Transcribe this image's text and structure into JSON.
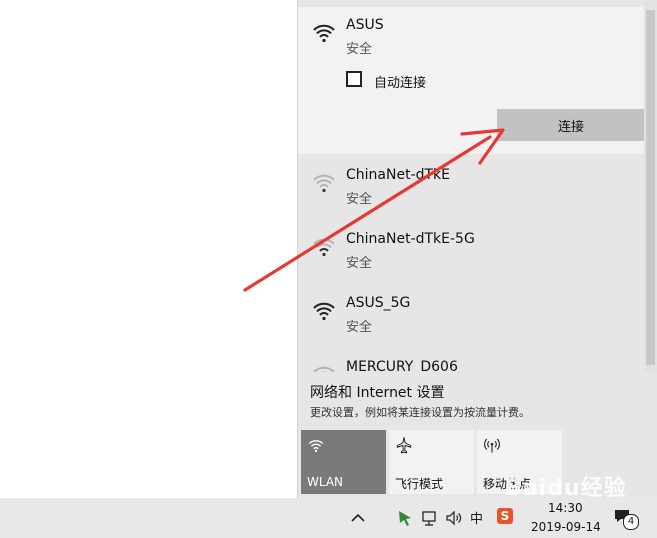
{
  "networks": [
    {
      "name": "ASUS",
      "status": "安全",
      "auto_connect_label": "自动连接",
      "auto_connect_checked": false,
      "connect_label": "连接",
      "signal": "full"
    },
    {
      "name": "ChinaNet-dTkE",
      "status": "安全",
      "signal": "weak"
    },
    {
      "name": "ChinaNet-dTkE-5G",
      "status": "安全",
      "signal": "weak"
    },
    {
      "name": "ASUS_5G",
      "status": "安全",
      "signal": "full"
    },
    {
      "name": "MERCURY_D606",
      "signal": "weak"
    }
  ],
  "settings": {
    "title": "网络和 Internet 设置",
    "description": "更改设置，例如将某连接设置为按流量计费。"
  },
  "quick_actions": [
    {
      "label": "WLAN",
      "active": true,
      "icon": "wifi-icon"
    },
    {
      "label": "飞行模式",
      "active": false,
      "icon": "airplane-icon"
    },
    {
      "label": "移动热点",
      "active": false,
      "icon": "hotspot-icon"
    }
  ],
  "taskbar": {
    "time": "14:30",
    "date": "2019-09-14",
    "notification_count": "4",
    "ime_label": "中",
    "sogou_label": "S"
  },
  "watermark": "Baidu经验",
  "colors": {
    "annotation_arrow": "#e53935",
    "active_tile": "#7a7a7a",
    "connect_button": "#c2c2c2"
  }
}
